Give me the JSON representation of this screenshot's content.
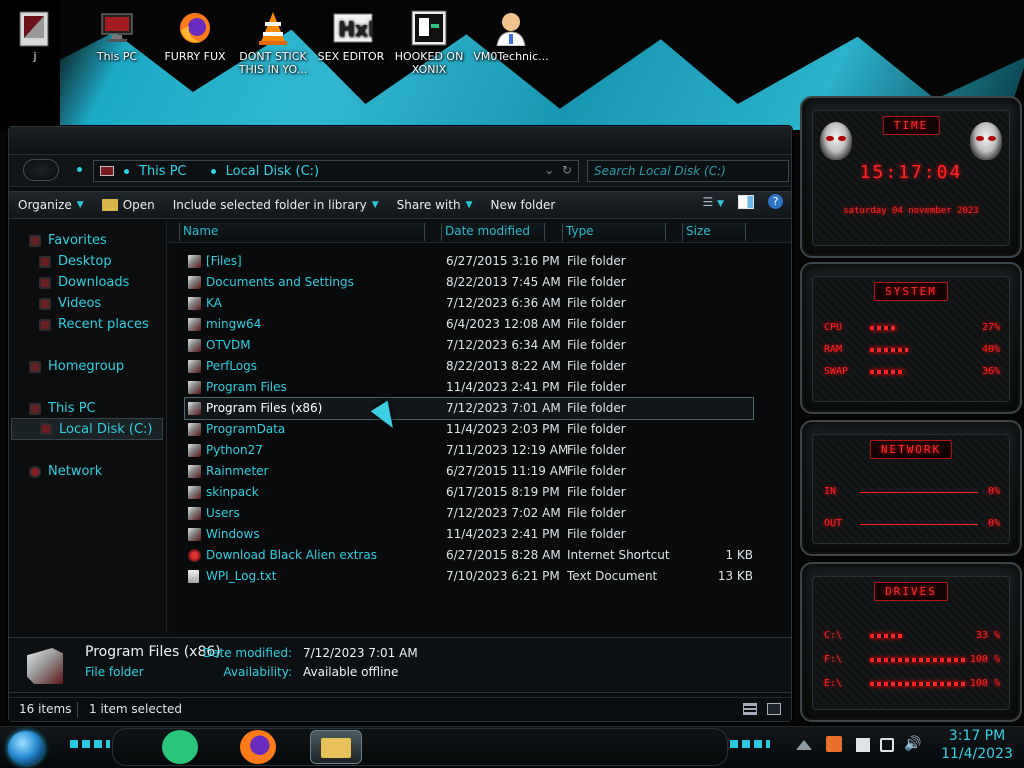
{
  "desktop": {
    "icons": [
      {
        "label": "j",
        "icon": "user-folder-icon"
      },
      {
        "label": "This PC",
        "icon": "computer-icon"
      },
      {
        "label": "FURRY FUX",
        "icon": "firefox-icon"
      },
      {
        "label": "DONT STICK THIS IN YO...",
        "icon": "vlc-cone-icon"
      },
      {
        "label": "SEX EDITOR",
        "icon": "hex-editor-icon"
      },
      {
        "label": "HOOKED ON XONIX",
        "icon": "game-icon"
      },
      {
        "label": "VM0Technic...",
        "icon": "doctor-icon"
      }
    ]
  },
  "explorer": {
    "breadcrumb": [
      "This PC",
      "Local Disk (C:)"
    ],
    "search_placeholder": "Search Local Disk (C:)",
    "toolbar": {
      "organize": "Organize",
      "open": "Open",
      "include": "Include selected folder in library",
      "share": "Share with",
      "new_folder": "New folder"
    },
    "nav": {
      "favorites": "Favorites",
      "desktop": "Desktop",
      "downloads": "Downloads",
      "videos": "Videos",
      "recent": "Recent places",
      "homegroup": "Homegroup",
      "thispc": "This PC",
      "localdisk": "Local Disk (C:)",
      "network": "Network"
    },
    "columns": {
      "name": "Name",
      "date": "Date modified",
      "type": "Type",
      "size": "Size"
    },
    "files": [
      {
        "name": "[Files]",
        "date": "6/27/2015 3:16 PM",
        "type": "File folder",
        "size": ""
      },
      {
        "name": "Documents and Settings",
        "date": "8/22/2013 7:45 AM",
        "type": "File folder",
        "size": ""
      },
      {
        "name": "KA",
        "date": "7/12/2023 6:36 AM",
        "type": "File folder",
        "size": ""
      },
      {
        "name": "mingw64",
        "date": "6/4/2023 12:08 AM",
        "type": "File folder",
        "size": ""
      },
      {
        "name": "OTVDM",
        "date": "7/12/2023 6:34 AM",
        "type": "File folder",
        "size": ""
      },
      {
        "name": "PerfLogs",
        "date": "8/22/2013 8:22 AM",
        "type": "File folder",
        "size": ""
      },
      {
        "name": "Program Files",
        "date": "11/4/2023 2:41 PM",
        "type": "File folder",
        "size": ""
      },
      {
        "name": "Program Files (x86)",
        "date": "7/12/2023 7:01 AM",
        "type": "File folder",
        "size": ""
      },
      {
        "name": "ProgramData",
        "date": "11/4/2023 2:03 PM",
        "type": "File folder",
        "size": ""
      },
      {
        "name": "Python27",
        "date": "7/11/2023 12:19 AM",
        "type": "File folder",
        "size": ""
      },
      {
        "name": "Rainmeter",
        "date": "6/27/2015 11:19 AM",
        "type": "File folder",
        "size": ""
      },
      {
        "name": "skinpack",
        "date": "6/17/2015 8:19 PM",
        "type": "File folder",
        "size": ""
      },
      {
        "name": "Users",
        "date": "7/12/2023 7:02 AM",
        "type": "File folder",
        "size": ""
      },
      {
        "name": "Windows",
        "date": "11/4/2023 2:41 PM",
        "type": "File folder",
        "size": ""
      },
      {
        "name": "Download Black Alien extras",
        "date": "6/27/2015 8:28 AM",
        "type": "Internet Shortcut",
        "size": "1 KB"
      },
      {
        "name": "WPI_Log.txt",
        "date": "7/10/2023 6:21 PM",
        "type": "Text Document",
        "size": "13 KB"
      }
    ],
    "details": {
      "name": "Program Files (x86)",
      "type": "File folder",
      "date_label": "Date modified:",
      "date_value": "7/12/2023 7:01 AM",
      "avail_label": "Availability:",
      "avail_value": "Available offline"
    },
    "status": {
      "items": "16 items",
      "selected": "1 item selected"
    }
  },
  "gadgets": {
    "time": {
      "title": "TIME",
      "clock": "15:17:04",
      "date": "saturday 04 november 2023"
    },
    "system": {
      "title": "SYSTEM",
      "rows": [
        {
          "label": "CPU",
          "pct": "27%",
          "level": 0.27
        },
        {
          "label": "RAM",
          "pct": "40%",
          "level": 0.4
        },
        {
          "label": "SWAP",
          "pct": "36%",
          "level": 0.36
        }
      ]
    },
    "network": {
      "title": "NETWORK",
      "rows": [
        {
          "label": "IN",
          "pct": "0%"
        },
        {
          "label": "OUT",
          "pct": "0%"
        }
      ]
    },
    "drives": {
      "title": "DRIVES",
      "rows": [
        {
          "label": "C:\\",
          "pct": "33 %",
          "level": 0.33
        },
        {
          "label": "F:\\",
          "pct": "100 %",
          "level": 1.0
        },
        {
          "label": "E:\\",
          "pct": "100 %",
          "level": 1.0
        }
      ]
    }
  },
  "taskbar": {
    "apps": [
      "notes-app-icon",
      "firefox-icon",
      "file-explorer-icon"
    ],
    "time": "3:17 PM",
    "date": "11/4/2023",
    "accent": "#33d1e6"
  },
  "colors": {
    "accent": "#2bd0e0",
    "alert": "#ff2424",
    "wallpaper_paint": "#2fc1dc"
  }
}
